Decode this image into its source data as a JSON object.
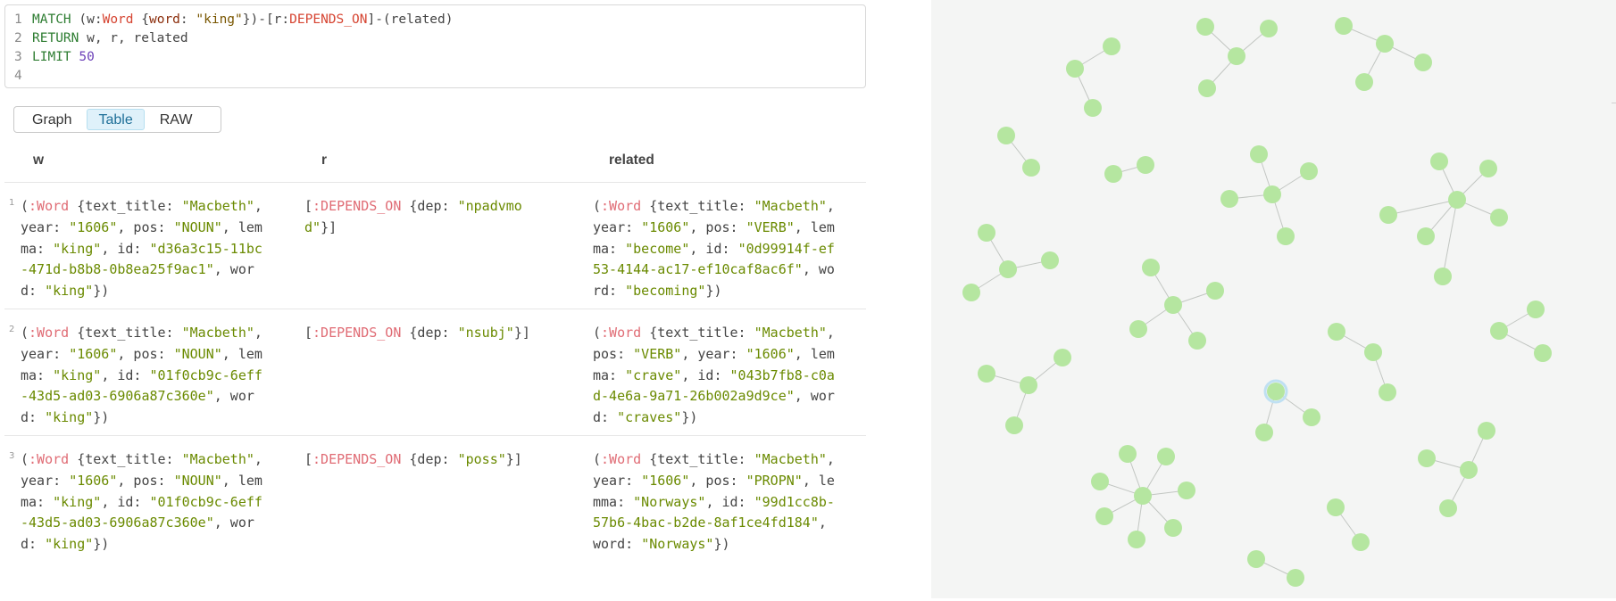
{
  "query": {
    "lines": [
      {
        "n": "1",
        "parts": [
          {
            "t": "MATCH ",
            "c": "kw"
          },
          {
            "t": "(w:",
            "c": "plain"
          },
          {
            "t": "Word",
            "c": "label"
          },
          {
            "t": " {",
            "c": "plain"
          },
          {
            "t": "word",
            "c": "prop"
          },
          {
            "t": ": ",
            "c": "plain"
          },
          {
            "t": "\"king\"",
            "c": "str"
          },
          {
            "t": "})-[r:",
            "c": "plain"
          },
          {
            "t": "DEPENDS_ON",
            "c": "label"
          },
          {
            "t": "]-(related)",
            "c": "plain"
          }
        ]
      },
      {
        "n": "2",
        "parts": [
          {
            "t": "RETURN ",
            "c": "kw"
          },
          {
            "t": "w, r, related",
            "c": "plain"
          }
        ]
      },
      {
        "n": "3",
        "parts": [
          {
            "t": "LIMIT ",
            "c": "kw"
          },
          {
            "t": "50",
            "c": "num"
          }
        ]
      },
      {
        "n": "4",
        "parts": []
      }
    ]
  },
  "view_tabs": {
    "graph": "Graph",
    "table": "Table",
    "raw": "RAW",
    "active": "table"
  },
  "table": {
    "headers": {
      "w": "w",
      "r": "r",
      "related": "related"
    },
    "rows": [
      {
        "num": "1",
        "w": [
          [
            {
              "t": "(",
              "c": "plain"
            },
            {
              "t": ":Word",
              "c": "label"
            },
            {
              "t": " {text_title: ",
              "c": "plain"
            },
            {
              "t": "\"Macbeth\"",
              "c": "str"
            },
            {
              "t": ",",
              "c": "plain"
            }
          ],
          [
            {
              "t": "year: ",
              "c": "plain"
            },
            {
              "t": "\"1606\"",
              "c": "str"
            },
            {
              "t": ", pos: ",
              "c": "plain"
            },
            {
              "t": "\"NOUN\"",
              "c": "str"
            },
            {
              "t": ", lem",
              "c": "plain"
            }
          ],
          [
            {
              "t": "ma: ",
              "c": "plain"
            },
            {
              "t": "\"king\"",
              "c": "str"
            },
            {
              "t": ", id: ",
              "c": "plain"
            },
            {
              "t": "\"d36a3c15-11bc",
              "c": "str"
            }
          ],
          [
            {
              "t": "-471d-b8b8-0b8ea25f9ac1\"",
              "c": "str"
            },
            {
              "t": ", wor",
              "c": "plain"
            }
          ],
          [
            {
              "t": "d: ",
              "c": "plain"
            },
            {
              "t": "\"king\"",
              "c": "str"
            },
            {
              "t": "})",
              "c": "plain"
            }
          ]
        ],
        "r": [
          [
            {
              "t": "[",
              "c": "plain"
            },
            {
              "t": ":DEPENDS_ON",
              "c": "rel"
            },
            {
              "t": " {dep: ",
              "c": "plain"
            },
            {
              "t": "\"npadvmo",
              "c": "str"
            }
          ],
          [
            {
              "t": "d\"",
              "c": "str"
            },
            {
              "t": "}]",
              "c": "plain"
            }
          ]
        ],
        "related": [
          [
            {
              "t": "(",
              "c": "plain"
            },
            {
              "t": ":Word",
              "c": "label"
            },
            {
              "t": " {text_title: ",
              "c": "plain"
            },
            {
              "t": "\"Macbeth\"",
              "c": "str"
            },
            {
              "t": ",",
              "c": "plain"
            }
          ],
          [
            {
              "t": "year: ",
              "c": "plain"
            },
            {
              "t": "\"1606\"",
              "c": "str"
            },
            {
              "t": ", pos: ",
              "c": "plain"
            },
            {
              "t": "\"VERB\"",
              "c": "str"
            },
            {
              "t": ", lem",
              "c": "plain"
            }
          ],
          [
            {
              "t": "ma: ",
              "c": "plain"
            },
            {
              "t": "\"become\"",
              "c": "str"
            },
            {
              "t": ", id: ",
              "c": "plain"
            },
            {
              "t": "\"0d99914f-ef",
              "c": "str"
            }
          ],
          [
            {
              "t": "53-4144-ac17-ef10caf8ac6f\"",
              "c": "str"
            },
            {
              "t": ", wo",
              "c": "plain"
            }
          ],
          [
            {
              "t": "rd: ",
              "c": "plain"
            },
            {
              "t": "\"becoming\"",
              "c": "str"
            },
            {
              "t": "})",
              "c": "plain"
            }
          ]
        ]
      },
      {
        "num": "2",
        "w": [
          [
            {
              "t": "(",
              "c": "plain"
            },
            {
              "t": ":Word",
              "c": "label"
            },
            {
              "t": " {text_title: ",
              "c": "plain"
            },
            {
              "t": "\"Macbeth\"",
              "c": "str"
            },
            {
              "t": ",",
              "c": "plain"
            }
          ],
          [
            {
              "t": "year: ",
              "c": "plain"
            },
            {
              "t": "\"1606\"",
              "c": "str"
            },
            {
              "t": ", pos: ",
              "c": "plain"
            },
            {
              "t": "\"NOUN\"",
              "c": "str"
            },
            {
              "t": ", lem",
              "c": "plain"
            }
          ],
          [
            {
              "t": "ma: ",
              "c": "plain"
            },
            {
              "t": "\"king\"",
              "c": "str"
            },
            {
              "t": ", id: ",
              "c": "plain"
            },
            {
              "t": "\"01f0cb9c-6eff",
              "c": "str"
            }
          ],
          [
            {
              "t": "-43d5-ad03-6906a87c360e\"",
              "c": "str"
            },
            {
              "t": ", wor",
              "c": "plain"
            }
          ],
          [
            {
              "t": "d: ",
              "c": "plain"
            },
            {
              "t": "\"king\"",
              "c": "str"
            },
            {
              "t": "})",
              "c": "plain"
            }
          ]
        ],
        "r": [
          [
            {
              "t": "[",
              "c": "plain"
            },
            {
              "t": ":DEPENDS_ON",
              "c": "rel"
            },
            {
              "t": " {dep: ",
              "c": "plain"
            },
            {
              "t": "\"nsubj\"",
              "c": "str"
            },
            {
              "t": "}]",
              "c": "plain"
            }
          ]
        ],
        "related": [
          [
            {
              "t": "(",
              "c": "plain"
            },
            {
              "t": ":Word",
              "c": "label"
            },
            {
              "t": " {text_title: ",
              "c": "plain"
            },
            {
              "t": "\"Macbeth\"",
              "c": "str"
            },
            {
              "t": ",",
              "c": "plain"
            }
          ],
          [
            {
              "t": "pos: ",
              "c": "plain"
            },
            {
              "t": "\"VERB\"",
              "c": "str"
            },
            {
              "t": ", year: ",
              "c": "plain"
            },
            {
              "t": "\"1606\"",
              "c": "str"
            },
            {
              "t": ", lem",
              "c": "plain"
            }
          ],
          [
            {
              "t": "ma: ",
              "c": "plain"
            },
            {
              "t": "\"crave\"",
              "c": "str"
            },
            {
              "t": ", id: ",
              "c": "plain"
            },
            {
              "t": "\"043b7fb8-c0a",
              "c": "str"
            }
          ],
          [
            {
              "t": "d-4e6a-9a71-26b002a9d9ce\"",
              "c": "str"
            },
            {
              "t": ", wor",
              "c": "plain"
            }
          ],
          [
            {
              "t": "d: ",
              "c": "plain"
            },
            {
              "t": "\"craves\"",
              "c": "str"
            },
            {
              "t": "})",
              "c": "plain"
            }
          ]
        ]
      },
      {
        "num": "3",
        "w": [
          [
            {
              "t": "(",
              "c": "plain"
            },
            {
              "t": ":Word",
              "c": "label"
            },
            {
              "t": " {text_title: ",
              "c": "plain"
            },
            {
              "t": "\"Macbeth\"",
              "c": "str"
            },
            {
              "t": ",",
              "c": "plain"
            }
          ],
          [
            {
              "t": "year: ",
              "c": "plain"
            },
            {
              "t": "\"1606\"",
              "c": "str"
            },
            {
              "t": ", pos: ",
              "c": "plain"
            },
            {
              "t": "\"NOUN\"",
              "c": "str"
            },
            {
              "t": ", lem",
              "c": "plain"
            }
          ],
          [
            {
              "t": "ma: ",
              "c": "plain"
            },
            {
              "t": "\"king\"",
              "c": "str"
            },
            {
              "t": ", id: ",
              "c": "plain"
            },
            {
              "t": "\"01f0cb9c-6eff",
              "c": "str"
            }
          ],
          [
            {
              "t": "-43d5-ad03-6906a87c360e\"",
              "c": "str"
            },
            {
              "t": ", wor",
              "c": "plain"
            }
          ],
          [
            {
              "t": "d: ",
              "c": "plain"
            },
            {
              "t": "\"king\"",
              "c": "str"
            },
            {
              "t": "})",
              "c": "plain"
            }
          ]
        ],
        "r": [
          [
            {
              "t": "[",
              "c": "plain"
            },
            {
              "t": ":DEPENDS_ON",
              "c": "rel"
            },
            {
              "t": " {dep: ",
              "c": "plain"
            },
            {
              "t": "\"poss\"",
              "c": "str"
            },
            {
              "t": "}]",
              "c": "plain"
            }
          ]
        ],
        "related": [
          [
            {
              "t": "(",
              "c": "plain"
            },
            {
              "t": ":Word",
              "c": "label"
            },
            {
              "t": " {text_title: ",
              "c": "plain"
            },
            {
              "t": "\"Macbeth\"",
              "c": "str"
            },
            {
              "t": ",",
              "c": "plain"
            }
          ],
          [
            {
              "t": "year: ",
              "c": "plain"
            },
            {
              "t": "\"1606\"",
              "c": "str"
            },
            {
              "t": ", pos: ",
              "c": "plain"
            },
            {
              "t": "\"PROPN\"",
              "c": "str"
            },
            {
              "t": ", le",
              "c": "plain"
            }
          ],
          [
            {
              "t": "mma: ",
              "c": "plain"
            },
            {
              "t": "\"Norways\"",
              "c": "str"
            },
            {
              "t": ", id: ",
              "c": "plain"
            },
            {
              "t": "\"99d1cc8b-",
              "c": "str"
            }
          ],
          [
            {
              "t": "57b6-4bac-b2de-8af1ce4fd184\"",
              "c": "str"
            },
            {
              "t": ",",
              "c": "plain"
            }
          ],
          [
            {
              "t": "word: ",
              "c": "plain"
            },
            {
              "t": "\"Norways\"",
              "c": "str"
            },
            {
              "t": "})",
              "c": "plain"
            }
          ]
        ]
      }
    ]
  },
  "graph_colors": {
    "node": "#b5e6a0",
    "edge": "#c2c6c2",
    "highlight": "#bfe0f2"
  }
}
